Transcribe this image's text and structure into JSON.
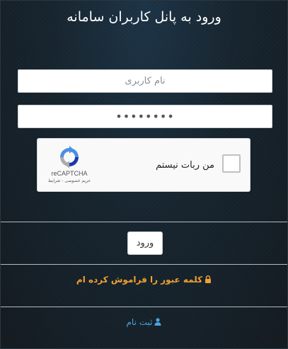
{
  "login": {
    "title": "ورود به پانل کاربران سامانه",
    "username_placeholder": "نام کاربری",
    "password_value": "••••••••",
    "submit_label": "ورود",
    "forgot_password_label": "کلمه عبور را فراموش کرده ام",
    "register_label": "ثبت نام"
  },
  "recaptcha": {
    "checkbox_label": "من ربات نیستم",
    "brand": "reCAPTCHA",
    "privacy_terms": "حریم خصوصی - شرایط"
  },
  "colors": {
    "background": "#16242e",
    "forgot_link": "#f0a030",
    "register_link": "#4aa3e0"
  },
  "icons": {
    "forgot": "lock-icon",
    "register": "user-icon"
  }
}
